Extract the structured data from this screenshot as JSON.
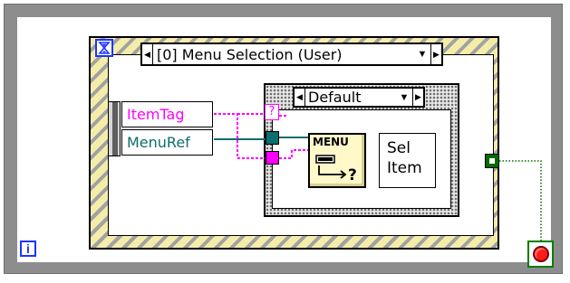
{
  "block_diagram": {
    "while_loop": {
      "iteration_label": "i",
      "stop_icon": "stop-button-icon"
    },
    "event_structure": {
      "timeout_icon": "hourglass-icon",
      "selector_text": "[0] Menu Selection (User)"
    },
    "event_data_node": {
      "items": [
        {
          "label": "ItemTag",
          "color": "#ff00ff"
        },
        {
          "label": "MenuRef",
          "color": "#0f6d6d"
        }
      ]
    },
    "case_structure": {
      "selector_text": "Default",
      "question_tunnel": "?"
    },
    "menu_subvi": {
      "label": "MENU",
      "icon": "menu-item-icon"
    },
    "sel_item_indicator": {
      "line1": "Sel",
      "line2": "Item"
    },
    "colors": {
      "loop_border": "#8d8d8d",
      "event_hatch": "#f4eda9",
      "string_wire": "#ff00ff",
      "ref_wire": "#0f6d6d",
      "bool_wire": "#006b00",
      "stop_red": "#ff1b1b",
      "terminal_blue": "#1d34ff"
    }
  }
}
